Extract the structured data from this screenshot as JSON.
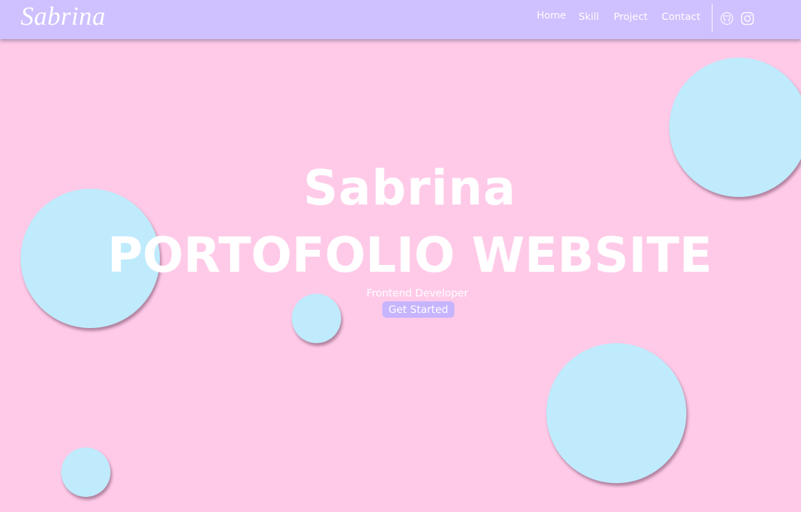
{
  "nav": {
    "logo": "Sabrina",
    "links": [
      "Home",
      "Skill",
      "Project",
      "Contact"
    ],
    "icons": [
      "github-icon",
      "instagram-icon"
    ]
  },
  "hero": {
    "name": "Sabrina",
    "title": "PORTOFOLIO WEBSITE",
    "role": "Frontend Developer",
    "cta": "Get Started"
  },
  "colors": {
    "background": "#ffcae8",
    "navbar": "#cfc0ff",
    "bubble": "#bfebfc",
    "button": "#c6b4ff",
    "text": "#ffffff"
  }
}
